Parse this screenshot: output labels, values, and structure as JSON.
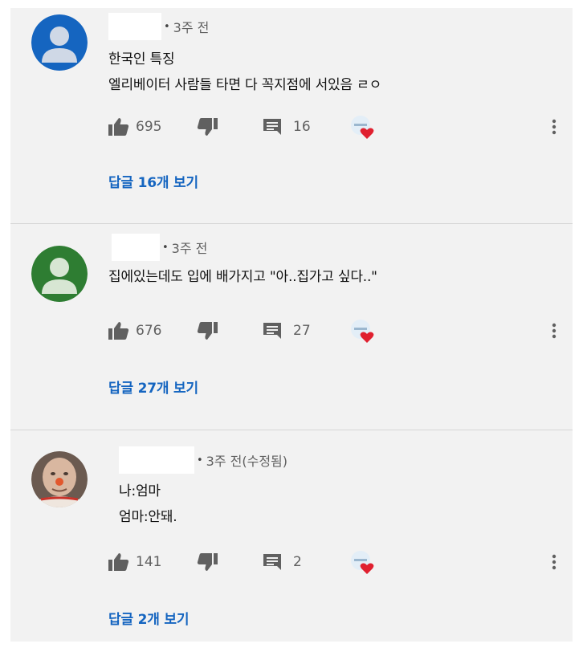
{
  "comments": [
    {
      "time": "3주 전",
      "lines": [
        "한국인 특징",
        "엘리베이터 사람들 타면 다 꼭지점에 서있음 ㄹㅇ"
      ],
      "likes": "695",
      "replies_count": "16",
      "view_replies": "답글 16개 보기",
      "avatar_color": "#1565c0"
    },
    {
      "time": "3주 전",
      "lines": [
        "집에있는데도 입에 배가지고 \"아..집가고 싶다..\""
      ],
      "likes": "676",
      "replies_count": "27",
      "view_replies": "답글 27개 보기",
      "avatar_color": "#2e7d32"
    },
    {
      "time": "3주 전(수정됨)",
      "lines": [
        "나:엄마",
        "엄마:안돼."
      ],
      "likes": "141",
      "replies_count": "2",
      "view_replies": "답글 2개 보기",
      "avatar_color": "#c9a48a"
    }
  ],
  "colors": {
    "link": "#1565c0",
    "heart": "#e0202f",
    "icon": "#606060"
  },
  "icons": [
    "person-icon",
    "thumbs-up-icon",
    "thumbs-down-icon",
    "comment-icon",
    "creator-heart-icon",
    "more-vert-icon"
  ]
}
